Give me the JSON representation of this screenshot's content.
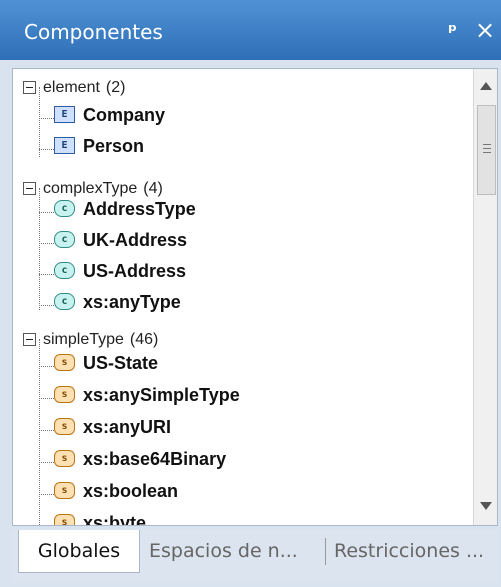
{
  "panel": {
    "title": "Componentes",
    "pin_icon": "pin-icon",
    "close_icon": "close-icon",
    "pin_glyph": "ᵖ",
    "close_glyph": "×"
  },
  "tree": {
    "groups": [
      {
        "label": "element",
        "count": "(2)",
        "items": [
          {
            "label": "Company",
            "icon": "element-icon",
            "badge": "E"
          },
          {
            "label": "Person",
            "icon": "element-icon",
            "badge": "E"
          }
        ]
      },
      {
        "label": "complexType",
        "count": "(4)",
        "items": [
          {
            "label": "AddressType",
            "icon": "complex-type-icon",
            "badge": "c"
          },
          {
            "label": "UK-Address",
            "icon": "complex-type-icon",
            "badge": "c"
          },
          {
            "label": "US-Address",
            "icon": "complex-type-icon",
            "badge": "c"
          },
          {
            "label": "xs:anyType",
            "icon": "complex-type-icon",
            "badge": "c"
          }
        ]
      },
      {
        "label": "simpleType",
        "count": "(46)",
        "items": [
          {
            "label": "US-State",
            "icon": "simple-type-icon",
            "badge": "s"
          },
          {
            "label": "xs:anySimpleType",
            "icon": "simple-type-icon",
            "badge": "s"
          },
          {
            "label": "xs:anyURI",
            "icon": "simple-type-icon",
            "badge": "s"
          },
          {
            "label": "xs:base64Binary",
            "icon": "simple-type-icon",
            "badge": "s"
          },
          {
            "label": "xs:boolean",
            "icon": "simple-type-icon",
            "badge": "s"
          },
          {
            "label": "xs:byte",
            "icon": "simple-type-icon",
            "badge": "s"
          }
        ]
      }
    ]
  },
  "tabs": [
    {
      "label": "Globales",
      "active": true
    },
    {
      "label": "Espacios de n...",
      "active": false
    },
    {
      "label": "Restricciones ...",
      "active": false
    }
  ],
  "colors": {
    "title_bar": "#3f86c9",
    "element_icon": "#cfe0ff",
    "complex_type_icon": "#c8f2ef",
    "simple_type_icon": "#ffe0b3"
  }
}
